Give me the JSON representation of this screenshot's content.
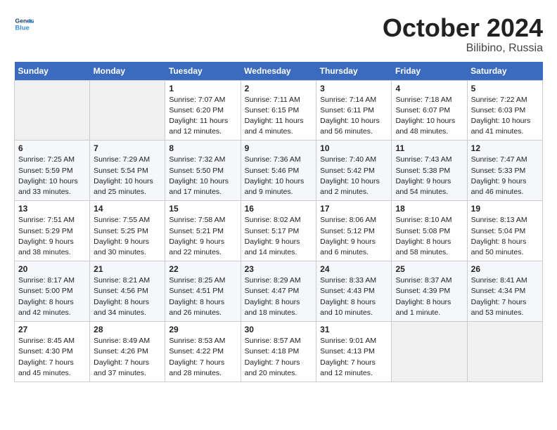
{
  "header": {
    "logo_line1": "General",
    "logo_line2": "Blue",
    "month": "October 2024",
    "location": "Bilibino, Russia"
  },
  "days_of_week": [
    "Sunday",
    "Monday",
    "Tuesday",
    "Wednesday",
    "Thursday",
    "Friday",
    "Saturday"
  ],
  "weeks": [
    [
      {
        "day": "",
        "info": ""
      },
      {
        "day": "",
        "info": ""
      },
      {
        "day": "1",
        "info": "Sunrise: 7:07 AM\nSunset: 6:20 PM\nDaylight: 11 hours and 12 minutes."
      },
      {
        "day": "2",
        "info": "Sunrise: 7:11 AM\nSunset: 6:15 PM\nDaylight: 11 hours and 4 minutes."
      },
      {
        "day": "3",
        "info": "Sunrise: 7:14 AM\nSunset: 6:11 PM\nDaylight: 10 hours and 56 minutes."
      },
      {
        "day": "4",
        "info": "Sunrise: 7:18 AM\nSunset: 6:07 PM\nDaylight: 10 hours and 48 minutes."
      },
      {
        "day": "5",
        "info": "Sunrise: 7:22 AM\nSunset: 6:03 PM\nDaylight: 10 hours and 41 minutes."
      }
    ],
    [
      {
        "day": "6",
        "info": "Sunrise: 7:25 AM\nSunset: 5:59 PM\nDaylight: 10 hours and 33 minutes."
      },
      {
        "day": "7",
        "info": "Sunrise: 7:29 AM\nSunset: 5:54 PM\nDaylight: 10 hours and 25 minutes."
      },
      {
        "day": "8",
        "info": "Sunrise: 7:32 AM\nSunset: 5:50 PM\nDaylight: 10 hours and 17 minutes."
      },
      {
        "day": "9",
        "info": "Sunrise: 7:36 AM\nSunset: 5:46 PM\nDaylight: 10 hours and 9 minutes."
      },
      {
        "day": "10",
        "info": "Sunrise: 7:40 AM\nSunset: 5:42 PM\nDaylight: 10 hours and 2 minutes."
      },
      {
        "day": "11",
        "info": "Sunrise: 7:43 AM\nSunset: 5:38 PM\nDaylight: 9 hours and 54 minutes."
      },
      {
        "day": "12",
        "info": "Sunrise: 7:47 AM\nSunset: 5:33 PM\nDaylight: 9 hours and 46 minutes."
      }
    ],
    [
      {
        "day": "13",
        "info": "Sunrise: 7:51 AM\nSunset: 5:29 PM\nDaylight: 9 hours and 38 minutes."
      },
      {
        "day": "14",
        "info": "Sunrise: 7:55 AM\nSunset: 5:25 PM\nDaylight: 9 hours and 30 minutes."
      },
      {
        "day": "15",
        "info": "Sunrise: 7:58 AM\nSunset: 5:21 PM\nDaylight: 9 hours and 22 minutes."
      },
      {
        "day": "16",
        "info": "Sunrise: 8:02 AM\nSunset: 5:17 PM\nDaylight: 9 hours and 14 minutes."
      },
      {
        "day": "17",
        "info": "Sunrise: 8:06 AM\nSunset: 5:12 PM\nDaylight: 9 hours and 6 minutes."
      },
      {
        "day": "18",
        "info": "Sunrise: 8:10 AM\nSunset: 5:08 PM\nDaylight: 8 hours and 58 minutes."
      },
      {
        "day": "19",
        "info": "Sunrise: 8:13 AM\nSunset: 5:04 PM\nDaylight: 8 hours and 50 minutes."
      }
    ],
    [
      {
        "day": "20",
        "info": "Sunrise: 8:17 AM\nSunset: 5:00 PM\nDaylight: 8 hours and 42 minutes."
      },
      {
        "day": "21",
        "info": "Sunrise: 8:21 AM\nSunset: 4:56 PM\nDaylight: 8 hours and 34 minutes."
      },
      {
        "day": "22",
        "info": "Sunrise: 8:25 AM\nSunset: 4:51 PM\nDaylight: 8 hours and 26 minutes."
      },
      {
        "day": "23",
        "info": "Sunrise: 8:29 AM\nSunset: 4:47 PM\nDaylight: 8 hours and 18 minutes."
      },
      {
        "day": "24",
        "info": "Sunrise: 8:33 AM\nSunset: 4:43 PM\nDaylight: 8 hours and 10 minutes."
      },
      {
        "day": "25",
        "info": "Sunrise: 8:37 AM\nSunset: 4:39 PM\nDaylight: 8 hours and 1 minute."
      },
      {
        "day": "26",
        "info": "Sunrise: 8:41 AM\nSunset: 4:34 PM\nDaylight: 7 hours and 53 minutes."
      }
    ],
    [
      {
        "day": "27",
        "info": "Sunrise: 8:45 AM\nSunset: 4:30 PM\nDaylight: 7 hours and 45 minutes."
      },
      {
        "day": "28",
        "info": "Sunrise: 8:49 AM\nSunset: 4:26 PM\nDaylight: 7 hours and 37 minutes."
      },
      {
        "day": "29",
        "info": "Sunrise: 8:53 AM\nSunset: 4:22 PM\nDaylight: 7 hours and 28 minutes."
      },
      {
        "day": "30",
        "info": "Sunrise: 8:57 AM\nSunset: 4:18 PM\nDaylight: 7 hours and 20 minutes."
      },
      {
        "day": "31",
        "info": "Sunrise: 9:01 AM\nSunset: 4:13 PM\nDaylight: 7 hours and 12 minutes."
      },
      {
        "day": "",
        "info": ""
      },
      {
        "day": "",
        "info": ""
      }
    ]
  ]
}
